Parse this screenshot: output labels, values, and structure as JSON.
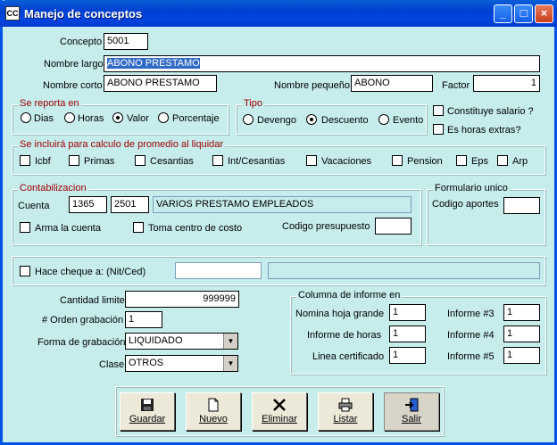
{
  "window": {
    "title": "Manejo de conceptos",
    "icon": "CC"
  },
  "fields": {
    "concepto_label": "Concepto",
    "concepto": "5001",
    "nombre_largo_label": "Nombre largo",
    "nombre_largo": "ABONO PRESTAMO",
    "nombre_corto_label": "Nombre corto",
    "nombre_corto": "ABONO PRESTAMO",
    "nombre_pequeno_label": "Nombre pequeño",
    "nombre_pequeno": "ABONO",
    "factor_label": "Factor",
    "factor": "1"
  },
  "reporta": {
    "title": "Se reporta en",
    "options": [
      "Dias",
      "Horas",
      "Valor",
      "Porcentaje"
    ],
    "selected": "Valor"
  },
  "tipo": {
    "title": "Tipo",
    "options": [
      "Devengo",
      "Descuento",
      "Evento"
    ],
    "selected": "Descuento"
  },
  "extra_checks": {
    "constituye": "Constituye salario ?",
    "horas_extras": "Es horas extras?"
  },
  "promedio": {
    "title": "Se incluirá para calculo de promedio al liquidar",
    "items": [
      "Icbf",
      "Primas",
      "Cesantias",
      "Int/Cesantias",
      "Vacaciones",
      "Pension",
      "Eps",
      "Arp"
    ]
  },
  "contabilizacion": {
    "title": "Contabilizacion",
    "cuenta_label": "Cuenta",
    "cuenta1": "1365",
    "cuenta2": "2501",
    "descripcion": "VARIOS PRESTAMO EMPLEADOS",
    "arma_label": "Arma la cuenta",
    "centro_label": "Toma centro de costo",
    "codigo_pres_label": "Codigo presupuesto",
    "codigo_pres": ""
  },
  "formulario": {
    "title": "Formulario unico",
    "codigo_label": "Codigo aportes",
    "codigo": ""
  },
  "cheque": {
    "label": "Hace cheque a: (Nit/Ced)",
    "nit": "",
    "nombre": ""
  },
  "lower": {
    "cantidad_label": "Cantidad limite",
    "cantidad": "999999",
    "orden_label": "# Orden grabación",
    "orden": "1",
    "forma_label": "Forma de grabación",
    "forma": "LIQUIDADO",
    "clase_label": "Clase",
    "clase": "OTROS"
  },
  "informe": {
    "title": "Columna de informe en",
    "nomina_label": "Nomina hoja grande",
    "nomina": "1",
    "horas_label": "Informe de horas",
    "horas": "1",
    "linea_label": "Linea certificado",
    "linea": "1",
    "i3_label": "Informe #3",
    "i3": "1",
    "i4_label": "Informe #4",
    "i4": "1",
    "i5_label": "Informe #5",
    "i5": "1"
  },
  "buttons": {
    "guardar": "Guardar",
    "nuevo": "Nuevo",
    "eliminar": "Eliminar",
    "listar": "Listar",
    "salir": "Salir"
  }
}
